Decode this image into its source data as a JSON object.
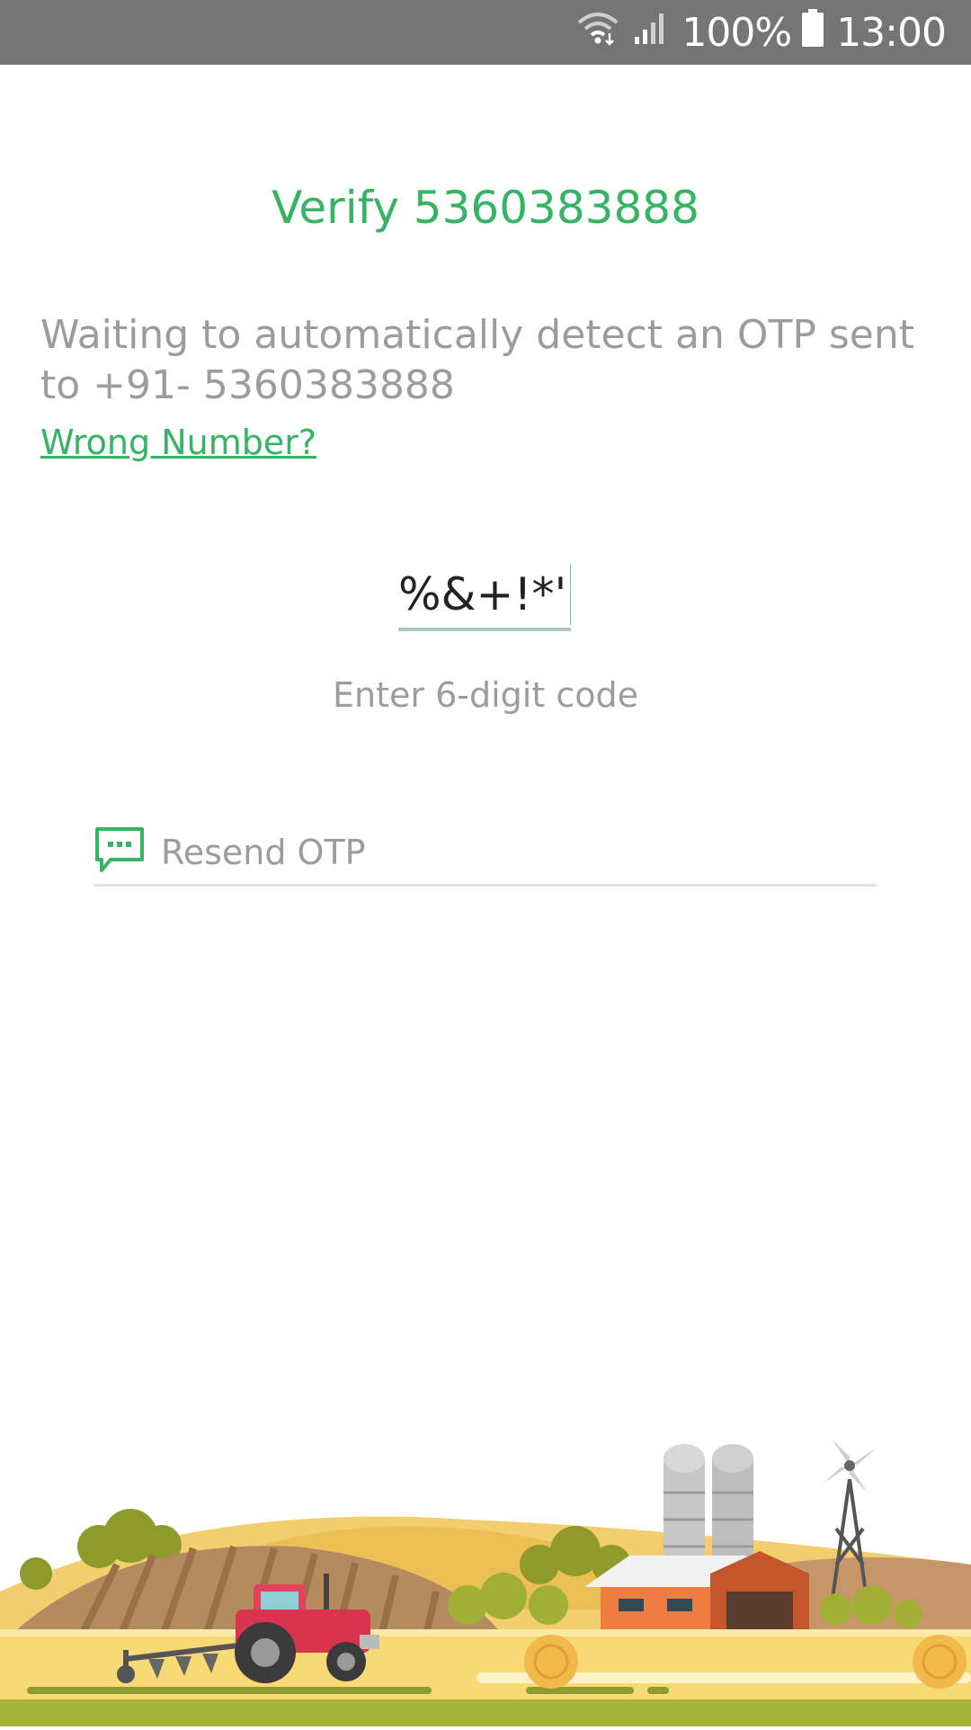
{
  "status_bar": {
    "battery": "100%",
    "time": "13:00",
    "icons": [
      "wifi-icon",
      "signal-icon",
      "battery-icon"
    ]
  },
  "verify": {
    "title": "Verify 5360383888",
    "message": "Waiting to automatically detect an OTP sent to +91- 5360383888",
    "wrong_number_label": "Wrong Number?"
  },
  "otp": {
    "value": "%&+!*'",
    "hint": "Enter 6-digit code"
  },
  "resend": {
    "label": "Resend OTP",
    "icon": "message-icon"
  },
  "colors": {
    "accent": "#35b463",
    "status_bar": "#757575",
    "muted_text": "#9c9c9c"
  }
}
